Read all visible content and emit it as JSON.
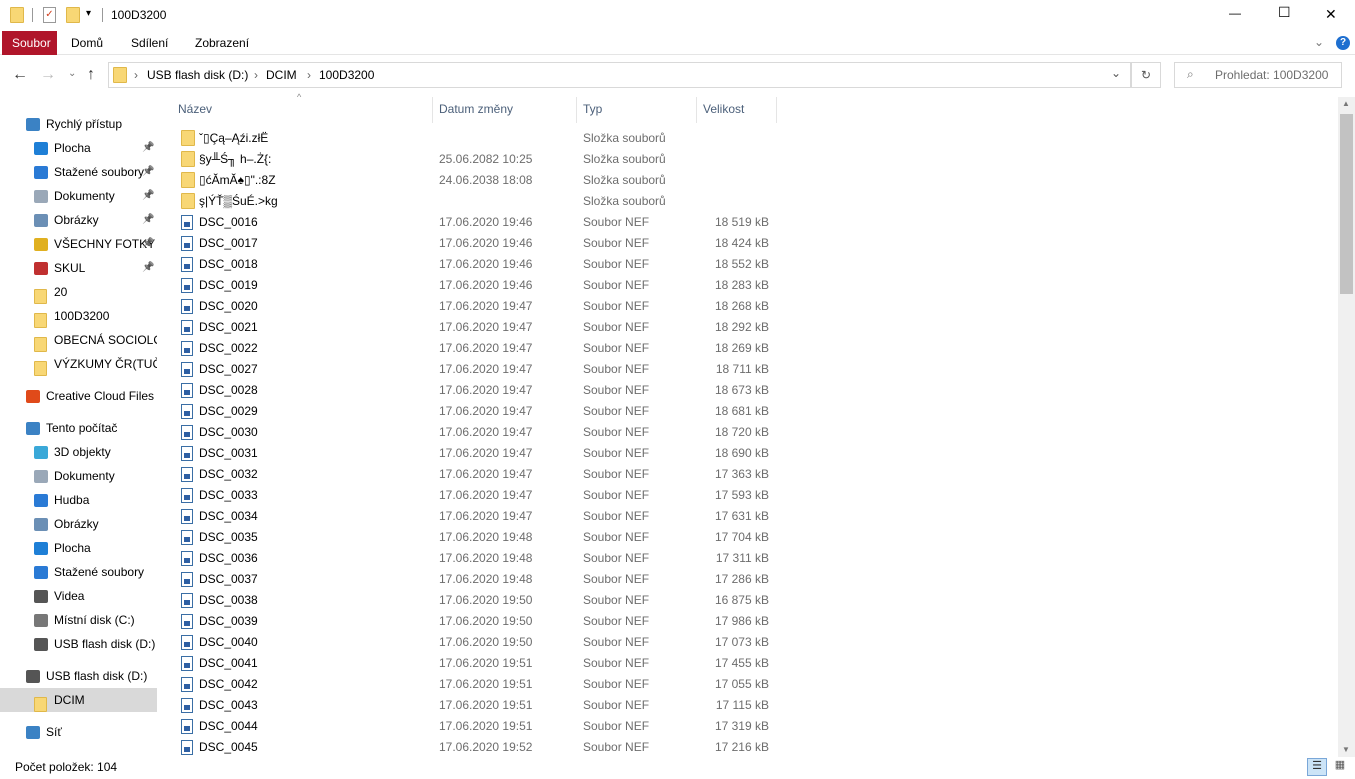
{
  "window": {
    "title": "100D3200",
    "minimize": "—",
    "maximize": "☐",
    "close": "✕"
  },
  "ribbon": {
    "tabs": [
      "Soubor",
      "Domů",
      "Sdílení",
      "Zobrazení"
    ],
    "active": "Soubor",
    "accent": "#b0152a"
  },
  "address": {
    "segments": [
      "USB flash disk (D:)",
      "DCIM",
      "100D3200"
    ],
    "refresh": "↻",
    "dropdown": "⌄"
  },
  "search": {
    "placeholder": "Prohledat: 100D3200"
  },
  "sidebar": {
    "items": [
      {
        "label": "Rychlý přístup",
        "icon": "star-icon",
        "level": 0,
        "color": "#3b82c4"
      },
      {
        "label": "Plocha",
        "icon": "desktop-icon",
        "level": 1,
        "pinned": true,
        "color": "#1e7fd6"
      },
      {
        "label": "Stažené soubory",
        "icon": "download-icon",
        "level": 1,
        "pinned": true,
        "color": "#2a7ad5"
      },
      {
        "label": "Dokumenty",
        "icon": "document-icon",
        "level": 1,
        "pinned": true,
        "color": "#9aa8b8"
      },
      {
        "label": "Obrázky",
        "icon": "pictures-icon",
        "level": 1,
        "pinned": true,
        "color": "#6b8fb5"
      },
      {
        "label": "VŠECHNY FOTKY",
        "icon": "shield-folder-icon",
        "level": 1,
        "pinned": true,
        "color": "#e0b020"
      },
      {
        "label": "SKUL",
        "icon": "colorful-folder-icon",
        "level": 1,
        "pinned": true,
        "color": "#c03030"
      },
      {
        "label": "20",
        "icon": "folder-icon",
        "level": 1
      },
      {
        "label": "100D3200",
        "icon": "folder-icon",
        "level": 1
      },
      {
        "label": "OBECNÁ SOCIOLOGIE",
        "icon": "folder-icon",
        "level": 1
      },
      {
        "label": "VÝZKUMY ČR(TUČEK)",
        "icon": "folder-icon",
        "level": 1
      },
      {
        "label": "Creative Cloud Files",
        "icon": "creative-cloud-icon",
        "level": 0,
        "gap": true,
        "color": "#e04a1a"
      },
      {
        "label": "Tento počítač",
        "icon": "computer-icon",
        "level": 0,
        "gap": true,
        "color": "#3b82c4"
      },
      {
        "label": "3D objekty",
        "icon": "cube-icon",
        "level": 1,
        "color": "#3aa8d8"
      },
      {
        "label": "Dokumenty",
        "icon": "document-icon",
        "level": 1,
        "color": "#9aa8b8"
      },
      {
        "label": "Hudba",
        "icon": "music-icon",
        "level": 1,
        "color": "#2a7ad5"
      },
      {
        "label": "Obrázky",
        "icon": "pictures-icon",
        "level": 1,
        "color": "#6b8fb5"
      },
      {
        "label": "Plocha",
        "icon": "desktop-icon",
        "level": 1,
        "color": "#1e7fd6"
      },
      {
        "label": "Stažené soubory",
        "icon": "download-icon",
        "level": 1,
        "color": "#2a7ad5"
      },
      {
        "label": "Videa",
        "icon": "video-icon",
        "level": 1,
        "color": "#555555"
      },
      {
        "label": "Místní disk (C:)",
        "icon": "drive-icon",
        "level": 1,
        "color": "#777777"
      },
      {
        "label": "USB flash disk (D:)",
        "icon": "usb-drive-icon",
        "level": 1,
        "color": "#555555"
      },
      {
        "label": "USB flash disk (D:)",
        "icon": "usb-drive-icon",
        "level": 0,
        "gap": true,
        "color": "#555555"
      },
      {
        "label": "DCIM",
        "icon": "folder-icon",
        "level": 1,
        "selected": true
      },
      {
        "label": "Síť",
        "icon": "network-icon",
        "level": 0,
        "gap": true,
        "color": "#3b82c4"
      }
    ]
  },
  "columns": {
    "name": "Název",
    "date": "Datum změny",
    "type": "Typ",
    "size": "Velikost"
  },
  "files": [
    {
      "name": "ˇ▯Çą–Ąźi.złË",
      "date": "",
      "type": "Složka souborů",
      "size": "",
      "folder": true
    },
    {
      "name": "§y╨Ś╖ h–.Ż{:",
      "date": "25.06.2082 10:25",
      "type": "Složka souborů",
      "size": "",
      "folder": true
    },
    {
      "name": "▯ćĂmĂ♠▯\".:8Z",
      "date": "24.06.2038 18:08",
      "type": "Složka souborů",
      "size": "",
      "folder": true
    },
    {
      "name": "ş|ÝŤ▒ŚuÉ.>kg",
      "date": "",
      "type": "Složka souborů",
      "size": "",
      "folder": true
    },
    {
      "name": "DSC_0016",
      "date": "17.06.2020 19:46",
      "type": "Soubor NEF",
      "size": "18 519 kB"
    },
    {
      "name": "DSC_0017",
      "date": "17.06.2020 19:46",
      "type": "Soubor NEF",
      "size": "18 424 kB"
    },
    {
      "name": "DSC_0018",
      "date": "17.06.2020 19:46",
      "type": "Soubor NEF",
      "size": "18 552 kB"
    },
    {
      "name": "DSC_0019",
      "date": "17.06.2020 19:46",
      "type": "Soubor NEF",
      "size": "18 283 kB"
    },
    {
      "name": "DSC_0020",
      "date": "17.06.2020 19:47",
      "type": "Soubor NEF",
      "size": "18 268 kB"
    },
    {
      "name": "DSC_0021",
      "date": "17.06.2020 19:47",
      "type": "Soubor NEF",
      "size": "18 292 kB"
    },
    {
      "name": "DSC_0022",
      "date": "17.06.2020 19:47",
      "type": "Soubor NEF",
      "size": "18 269 kB"
    },
    {
      "name": "DSC_0027",
      "date": "17.06.2020 19:47",
      "type": "Soubor NEF",
      "size": "18 711 kB"
    },
    {
      "name": "DSC_0028",
      "date": "17.06.2020 19:47",
      "type": "Soubor NEF",
      "size": "18 673 kB"
    },
    {
      "name": "DSC_0029",
      "date": "17.06.2020 19:47",
      "type": "Soubor NEF",
      "size": "18 681 kB"
    },
    {
      "name": "DSC_0030",
      "date": "17.06.2020 19:47",
      "type": "Soubor NEF",
      "size": "18 720 kB"
    },
    {
      "name": "DSC_0031",
      "date": "17.06.2020 19:47",
      "type": "Soubor NEF",
      "size": "18 690 kB"
    },
    {
      "name": "DSC_0032",
      "date": "17.06.2020 19:47",
      "type": "Soubor NEF",
      "size": "17 363 kB"
    },
    {
      "name": "DSC_0033",
      "date": "17.06.2020 19:47",
      "type": "Soubor NEF",
      "size": "17 593 kB"
    },
    {
      "name": "DSC_0034",
      "date": "17.06.2020 19:47",
      "type": "Soubor NEF",
      "size": "17 631 kB"
    },
    {
      "name": "DSC_0035",
      "date": "17.06.2020 19:48",
      "type": "Soubor NEF",
      "size": "17 704 kB"
    },
    {
      "name": "DSC_0036",
      "date": "17.06.2020 19:48",
      "type": "Soubor NEF",
      "size": "17 311 kB"
    },
    {
      "name": "DSC_0037",
      "date": "17.06.2020 19:48",
      "type": "Soubor NEF",
      "size": "17 286 kB"
    },
    {
      "name": "DSC_0038",
      "date": "17.06.2020 19:50",
      "type": "Soubor NEF",
      "size": "16 875 kB"
    },
    {
      "name": "DSC_0039",
      "date": "17.06.2020 19:50",
      "type": "Soubor NEF",
      "size": "17 986 kB"
    },
    {
      "name": "DSC_0040",
      "date": "17.06.2020 19:50",
      "type": "Soubor NEF",
      "size": "17 073 kB"
    },
    {
      "name": "DSC_0041",
      "date": "17.06.2020 19:51",
      "type": "Soubor NEF",
      "size": "17 455 kB"
    },
    {
      "name": "DSC_0042",
      "date": "17.06.2020 19:51",
      "type": "Soubor NEF",
      "size": "17 055 kB"
    },
    {
      "name": "DSC_0043",
      "date": "17.06.2020 19:51",
      "type": "Soubor NEF",
      "size": "17 115 kB"
    },
    {
      "name": "DSC_0044",
      "date": "17.06.2020 19:51",
      "type": "Soubor NEF",
      "size": "17 319 kB"
    },
    {
      "name": "DSC_0045",
      "date": "17.06.2020 19:52",
      "type": "Soubor NEF",
      "size": "17 216 kB"
    }
  ],
  "status": {
    "count": "Počet položek: 104"
  }
}
